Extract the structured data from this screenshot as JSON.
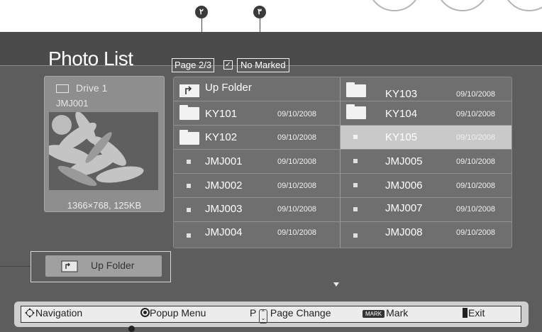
{
  "callouts": [
    "٢",
    "٣"
  ],
  "title": "Photo List",
  "page_indicator": "Page 2/3",
  "marked_status": "No Marked",
  "preview": {
    "drive": "Drive 1",
    "file": "JMJ001",
    "resolution": "1366×768, 125KB"
  },
  "up_folder_button": "Up Folder",
  "list": {
    "left": [
      {
        "name": "Up Folder",
        "date": "",
        "icon": "up-folder-icon"
      },
      {
        "name": "KY101",
        "date": "09/10/2008",
        "icon": "folder-icon"
      },
      {
        "name": "KY102",
        "date": "09/10/2008",
        "icon": "folder-icon"
      },
      {
        "name": "JMJ001",
        "date": "09/10/2008",
        "icon": "photo-file-icon"
      },
      {
        "name": "JMJ002",
        "date": "09/10/2008",
        "icon": "photo-file-icon"
      },
      {
        "name": "JMJ003",
        "date": "09/10/2008",
        "icon": "photo-file-icon"
      },
      {
        "name": "JMJ004",
        "date": "09/10/2008",
        "icon": "photo-file-icon"
      }
    ],
    "right": [
      {
        "name": "KY103",
        "date": "09/10/2008",
        "icon": "folder-icon"
      },
      {
        "name": "KY104",
        "date": "09/10/2008",
        "icon": "folder-icon"
      },
      {
        "name": "KY105",
        "date": "09/10/2008",
        "icon": "photo-file-icon",
        "selected": true
      },
      {
        "name": "JMJ005",
        "date": "09/10/2008",
        "icon": "photo-file-icon"
      },
      {
        "name": "JMJ006",
        "date": "09/10/2008",
        "icon": "photo-file-icon"
      },
      {
        "name": "JMJ007",
        "date": "09/10/2008",
        "icon": "photo-file-icon"
      },
      {
        "name": "JMJ008",
        "date": "09/10/2008",
        "icon": "photo-file-icon"
      }
    ]
  },
  "bottom_bar": {
    "navigation": "Navigation",
    "popup": "Popup Menu",
    "page_change_key": "P",
    "page_change": "Page Change",
    "mark_key": "MARK",
    "mark": "Mark",
    "exit": "Exit"
  },
  "colors": {
    "screen": "#5d5d5d",
    "selected": "#c9c9c9",
    "bar": "#cfcfcf"
  }
}
